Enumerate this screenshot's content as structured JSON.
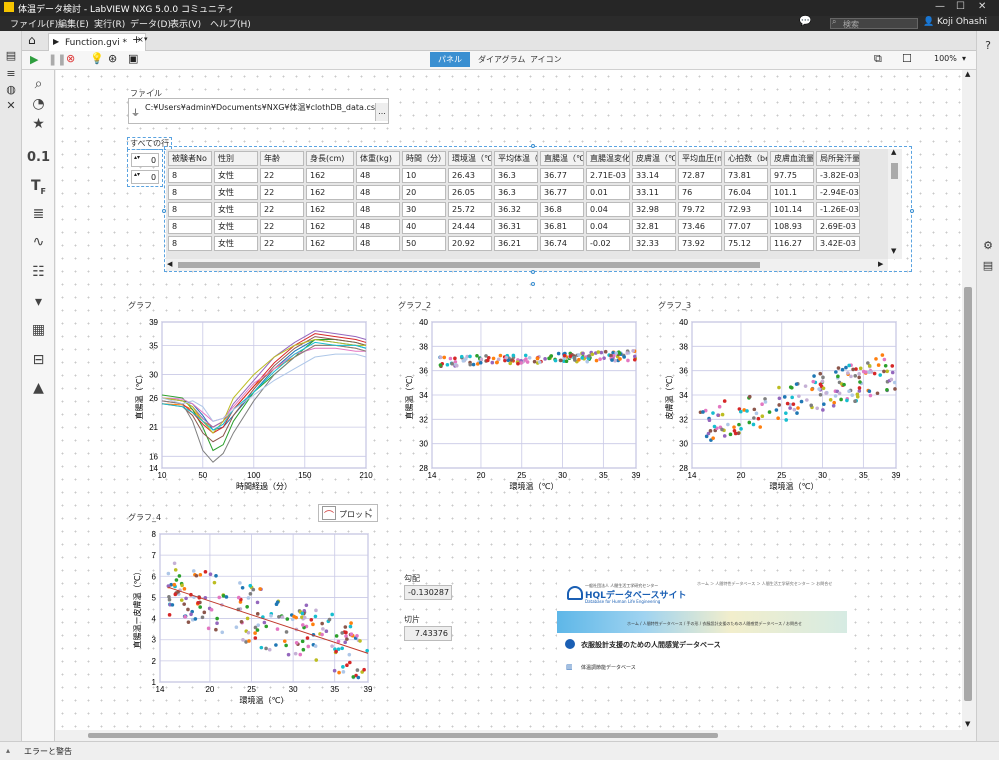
{
  "app": {
    "title": "体温データ検討 - LabVIEW NXG 5.0.0 コミュニティ",
    "user": "Koji Ohashi",
    "search_placeholder": "検索"
  },
  "menu": [
    "ファイル(F)",
    "編集(E)",
    "実行(R)",
    "データ(D)",
    "表示(V)",
    "ヘルプ(H)"
  ],
  "tabs": {
    "doc": "Function.gvi *",
    "add": "+"
  },
  "view_tabs": [
    "パネル",
    "ダイアグラム",
    "アイコン"
  ],
  "zoom": "100%",
  "file": {
    "label": "ファイル",
    "path": "C:¥Users¥admin¥Documents¥NXG¥体温¥clothDB_data.csv",
    "browse": "..."
  },
  "table": {
    "label": "すべての行",
    "row_index": "0",
    "col_index": "0",
    "headers": [
      "被験者No",
      "性別",
      "年齢",
      "身長(cm)",
      "体重(kg)",
      "時間（分）",
      "環境温（℃）",
      "平均体温（℃",
      "直腸温（℃）",
      "直腸温変化分",
      "皮膚温（℃）",
      "平均血圧(m",
      "心拍数（bea",
      "皮膚血流量(",
      "局所発汗量"
    ],
    "rows": [
      [
        "8",
        "女性",
        "22",
        "162",
        "48",
        "10",
        "26.43",
        "36.3",
        "36.77",
        "2.71E-03",
        "33.14",
        "72.87",
        "73.81",
        "97.75",
        "-3.82E-03"
      ],
      [
        "8",
        "女性",
        "22",
        "162",
        "48",
        "20",
        "26.05",
        "36.3",
        "36.77",
        "0.01",
        "33.11",
        "76",
        "76.04",
        "101.1",
        "-2.94E-03"
      ],
      [
        "8",
        "女性",
        "22",
        "162",
        "48",
        "30",
        "25.72",
        "36.32",
        "36.8",
        "0.04",
        "32.98",
        "79.72",
        "72.93",
        "101.14",
        "-1.26E-03"
      ],
      [
        "8",
        "女性",
        "22",
        "162",
        "48",
        "40",
        "24.44",
        "36.31",
        "36.81",
        "0.04",
        "32.81",
        "73.46",
        "77.07",
        "108.93",
        "2.69E-03"
      ],
      [
        "8",
        "女性",
        "22",
        "162",
        "48",
        "50",
        "20.92",
        "36.21",
        "36.74",
        "-0.02",
        "32.33",
        "73.92",
        "75.12",
        "116.27",
        "3.42E-03"
      ]
    ]
  },
  "graphs": {
    "g1": {
      "title": "グラフ",
      "xlabel": "時間経過（分）",
      "ylabel": "直腸温（℃）"
    },
    "g2": {
      "title": "グラフ_2",
      "xlabel": "環境温（℃）",
      "ylabel": "直腸温（℃）"
    },
    "g3": {
      "title": "グラフ_3",
      "xlabel": "環境温（℃）",
      "ylabel": "皮膚温（℃）"
    },
    "g4": {
      "title": "グラフ_4",
      "xlabel": "環境温（℃）",
      "ylabel": "直腸温ー皮膚温（℃）",
      "legend": "プロット"
    }
  },
  "fit": {
    "slope_label": "勾配",
    "slope": "-0.130287",
    "intercept_label": "切片",
    "intercept": "7.43376"
  },
  "banner": {
    "nav": "ホーム ＞ 人間特性データベース ＞ 人間生活工学研究センター ＞ お問合せ",
    "logo_text": "HQLデータベースサイト",
    "logo_sub": "Database for Human Life Engineering",
    "org": "一般社団法人 人間生活工学研究センター",
    "crumbs": "ホーム / 人間特性データベース / 手の形 / 衣服設計支援のための人間感覚データベース / お問合せ",
    "heading": "衣服設計支援のための人間感覚データベース",
    "link": "体温調節能データベース"
  },
  "status": {
    "errors": "エラーと警告"
  },
  "chart_data": [
    {
      "type": "line",
      "title": "",
      "xlabel": "時間経過（分）",
      "ylabel": "直腸温（℃）",
      "xlim": [
        10,
        210
      ],
      "ylim": [
        14,
        39
      ],
      "xticks": [
        10,
        50,
        100,
        150,
        210
      ],
      "yticks": [
        14,
        16,
        21,
        26,
        30,
        35,
        39
      ],
      "x": [
        10,
        30,
        40,
        50,
        60,
        70,
        80,
        100,
        120,
        140,
        160,
        180,
        200,
        210
      ],
      "series": [
        {
          "color": "#1f77b4",
          "values": [
            26,
            25.5,
            25,
            23,
            20.5,
            21,
            23,
            27,
            31,
            34,
            36,
            35.5,
            35,
            34.5
          ]
        },
        {
          "color": "#ff7f0e",
          "values": [
            25,
            24.8,
            24,
            22,
            21,
            22,
            24,
            28,
            31,
            33,
            35,
            35,
            34.5,
            34
          ]
        },
        {
          "color": "#2ca02c",
          "values": [
            26.5,
            26,
            24,
            21,
            17,
            18,
            22,
            27,
            30,
            33,
            36,
            36,
            35.5,
            35
          ]
        },
        {
          "color": "#d62728",
          "values": [
            25.5,
            25,
            23.5,
            21.5,
            20,
            21,
            24,
            28,
            32,
            35,
            37,
            36.5,
            36,
            35.5
          ]
        },
        {
          "color": "#9467bd",
          "values": [
            26,
            25.5,
            24.5,
            22.5,
            21,
            22,
            25,
            29,
            33,
            35.5,
            37.5,
            37,
            36.5,
            36
          ]
        },
        {
          "color": "#8c564b",
          "values": [
            25,
            24.5,
            23,
            20,
            18.5,
            19.5,
            23,
            27.5,
            31.5,
            34.5,
            36.5,
            36,
            35.5,
            35
          ]
        },
        {
          "color": "#e377c2",
          "values": [
            26,
            25.8,
            25,
            23.5,
            22,
            22.5,
            24.5,
            28.5,
            31,
            33.5,
            34.5,
            34.5,
            34,
            34
          ]
        },
        {
          "color": "#7f7f7f",
          "values": [
            25.5,
            25,
            22,
            17,
            15,
            16.5,
            20,
            25.5,
            30,
            33,
            35,
            35,
            34.5,
            34
          ]
        },
        {
          "color": "#bcbd22",
          "values": [
            26,
            25.5,
            24.5,
            22,
            20,
            22,
            26,
            30,
            33,
            35,
            36,
            35.5,
            35,
            35
          ]
        },
        {
          "color": "#17becf",
          "values": [
            25,
            24.5,
            23.5,
            22,
            20.5,
            21.5,
            24,
            27,
            30.5,
            33.5,
            35.5,
            35,
            35,
            34.5
          ]
        },
        {
          "color": "#aec7e8",
          "values": [
            26,
            25,
            25.5,
            24.5,
            22,
            22.5,
            24,
            26.5,
            29,
            31,
            33,
            33.5,
            33.5,
            33
          ]
        }
      ]
    },
    {
      "type": "scatter",
      "title": "",
      "xlabel": "環境温（℃）",
      "ylabel": "直腸温（℃）",
      "xlim": [
        14,
        39
      ],
      "ylim": [
        28,
        40
      ],
      "xticks": [
        14,
        20,
        25,
        30,
        35,
        39
      ],
      "yticks": [
        28,
        30,
        32,
        34,
        36,
        38,
        40
      ],
      "cloud": {
        "x_range": [
          15,
          39
        ],
        "y_center": 37,
        "y_spread": 0.4,
        "count": 160
      }
    },
    {
      "type": "scatter",
      "title": "",
      "xlabel": "環境温（℃）",
      "ylabel": "皮膚温（℃）",
      "xlim": [
        14,
        39
      ],
      "ylim": [
        28,
        40
      ],
      "xticks": [
        14,
        20,
        25,
        30,
        35,
        39
      ],
      "yticks": [
        28,
        30,
        32,
        34,
        36,
        38,
        40
      ],
      "cloud": {
        "x_range": [
          15,
          39
        ],
        "y_at_xmin": 31.5,
        "y_at_xmax": 36,
        "y_spread": 1.6,
        "count": 170
      }
    },
    {
      "type": "scatter",
      "title": "",
      "xlabel": "環境温（℃）",
      "ylabel": "直腸温ー皮膚温（℃）",
      "xlim": [
        14,
        39
      ],
      "ylim": [
        1,
        8
      ],
      "xticks": [
        14,
        20,
        25,
        30,
        35,
        39
      ],
      "yticks": [
        1,
        2,
        3,
        4,
        5,
        6,
        7,
        8
      ],
      "fit_line": {
        "slope": -0.130287,
        "intercept": 7.43376,
        "x_range": [
          15,
          39
        ]
      },
      "cloud": {
        "x_range": [
          15,
          39
        ],
        "y_spread": 1.4,
        "count": 200
      }
    }
  ]
}
